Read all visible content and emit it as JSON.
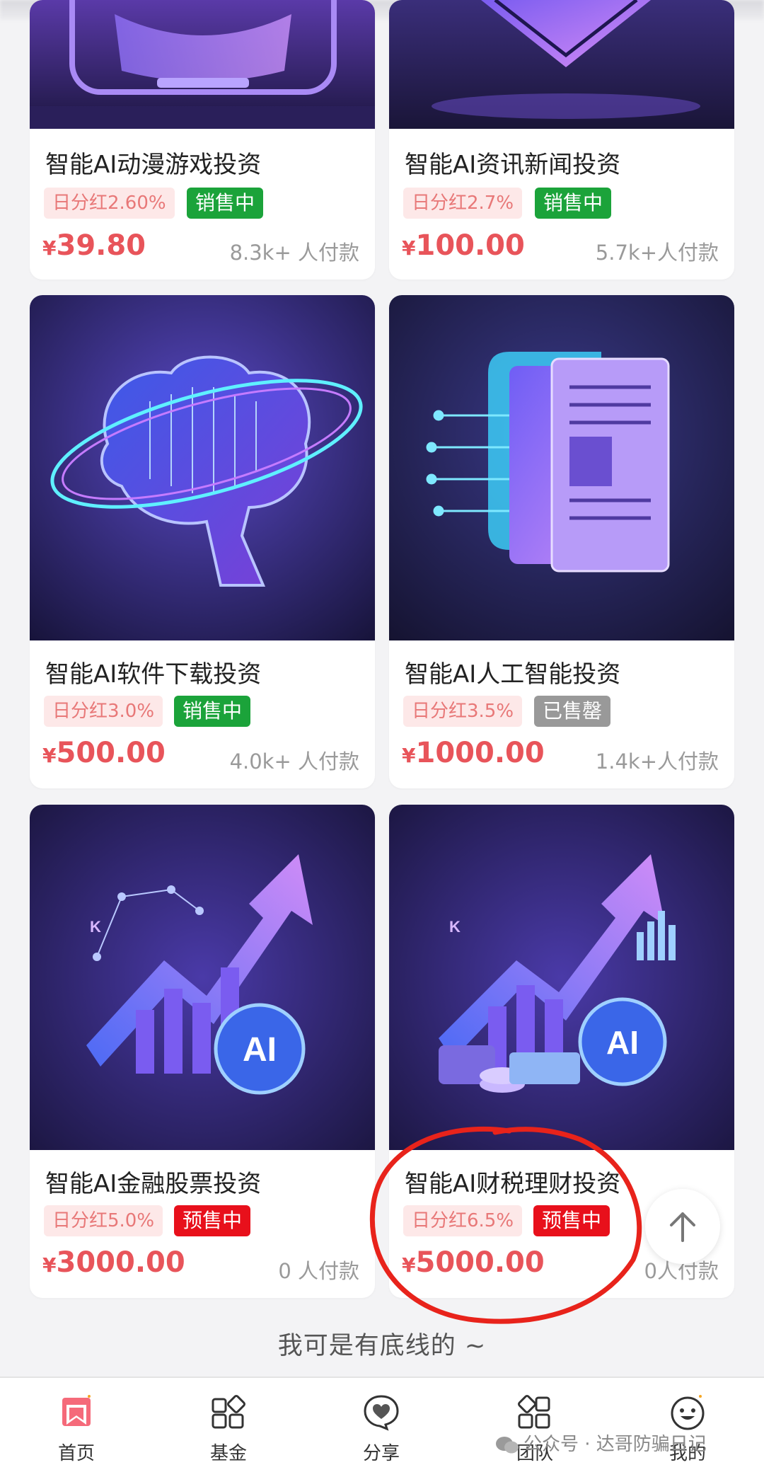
{
  "products": [
    {
      "title": "智能AI动漫游戏投资",
      "dividend": "日分红2.60%",
      "status": "销售中",
      "status_color": "#1ba33a",
      "price_symbol": "¥",
      "price": "39.80",
      "sold": "8.3k+ 人付款",
      "art": "gamepad-art"
    },
    {
      "title": "智能AI资讯新闻投资",
      "dividend": "日分红2.7%",
      "status": "销售中",
      "status_color": "#1ba33a",
      "price_symbol": "¥",
      "price": "100.00",
      "sold": "5.7k+人付款",
      "art": "crystal-art"
    },
    {
      "title": "智能AI软件下载投资",
      "dividend": "日分红3.0%",
      "status": "销售中",
      "status_color": "#1ba33a",
      "price_symbol": "¥",
      "price": "500.00",
      "sold": "4.0k+ 人付款",
      "art": "brain-art"
    },
    {
      "title": "智能AI人工智能投资",
      "dividend": "日分红3.5%",
      "status": "已售罄",
      "status_color": "#999999",
      "price_symbol": "¥",
      "price": "1000.00",
      "sold": "1.4k+人付款",
      "art": "newspaper-art"
    },
    {
      "title": "智能AI金融股票投资",
      "dividend": "日分红5.0%",
      "status": "预售中",
      "status_color": "#e8101b",
      "price_symbol": "¥",
      "price": "3000.00",
      "sold": "0 人付款",
      "art": "stock-chart-art"
    },
    {
      "title": "智能AI财税理财投资",
      "dividend": "日分红6.5%",
      "status": "预售中",
      "status_color": "#e8101b",
      "price_symbol": "¥",
      "price": "5000.00",
      "sold": "0人付款",
      "art": "finance-chart-art"
    }
  ],
  "art_labels": {
    "ai": "AI",
    "k": "K"
  },
  "footer_text": "我可是有底线的 ~",
  "tabs": [
    {
      "label": "首页",
      "icon": "home-bookmark-icon",
      "active": true
    },
    {
      "label": "基金",
      "icon": "grid-apps-icon"
    },
    {
      "label": "分享",
      "icon": "heart-chat-icon"
    },
    {
      "label": "团队",
      "icon": "team-grid-icon"
    },
    {
      "label": "我的",
      "icon": "smiley-face-icon"
    }
  ],
  "watermark": "公众号 · 达哥防骗日记",
  "colors": {
    "price": "#e8545a",
    "dividend_bg": "#fde8e8",
    "dividend_text": "#e87878",
    "annotation": "#e8231b"
  }
}
